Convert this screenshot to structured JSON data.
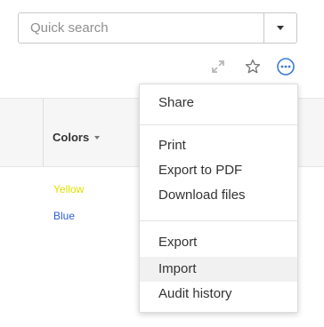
{
  "search": {
    "placeholder": "Quick search",
    "value": ""
  },
  "toolbar": {
    "icons": [
      "expand-icon",
      "star-icon",
      "more-options-icon"
    ],
    "accent": "#3a7bd5"
  },
  "table": {
    "column_header": "Colors",
    "rows": [
      {
        "value": "Yellow",
        "color": "#e0e000"
      },
      {
        "value": "Blue",
        "color": "#2f5fd8"
      }
    ]
  },
  "menu": {
    "groups": [
      [
        "Share"
      ],
      [
        "Print",
        "Export to PDF",
        "Download files"
      ],
      [
        "Export",
        "Import",
        "Audit history"
      ]
    ],
    "hovered": "Import"
  }
}
